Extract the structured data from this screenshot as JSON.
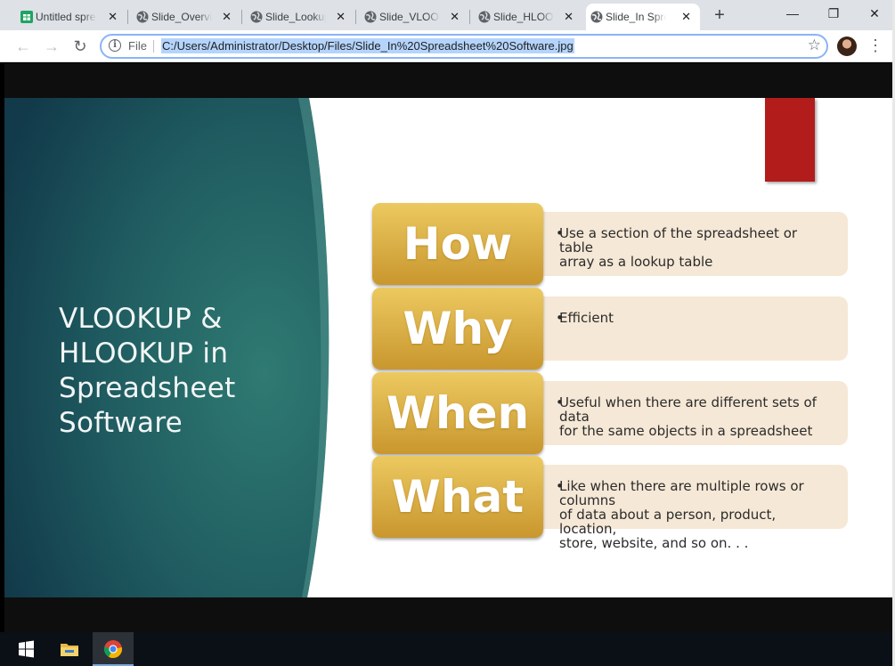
{
  "browser": {
    "tabs": [
      {
        "title": "Untitled spreadsheet",
        "icon": "sheets-icon",
        "active": false
      },
      {
        "title": "Slide_Overview",
        "icon": "globe-icon",
        "active": false
      },
      {
        "title": "Slide_Lookup",
        "icon": "globe-icon",
        "active": false
      },
      {
        "title": "Slide_VLOOKUP",
        "icon": "globe-icon",
        "active": false
      },
      {
        "title": "Slide_HLOOKUP",
        "icon": "globe-icon",
        "active": false
      },
      {
        "title": "Slide_In Spreadsheet",
        "icon": "globe-icon",
        "active": true
      }
    ],
    "scheme_label": "File",
    "url": "C:/Users/Administrator/Desktop/Files/Slide_In%20Spreadsheet%20Software.jpg",
    "accent_color": "#8ab4f8"
  },
  "slide": {
    "title_lines": [
      "VLOOKUP &",
      "HLOOKUP in",
      "Spreadsheet",
      "Software"
    ],
    "rows": [
      {
        "word": "How",
        "lines": [
          "Use a section of the spreadsheet or table",
          "array as a lookup table"
        ]
      },
      {
        "word": "Why",
        "lines": [
          "Efficient"
        ]
      },
      {
        "word": "When",
        "lines": [
          "Useful when there are different sets of data",
          "for the same objects in a spreadsheet"
        ]
      },
      {
        "word": "What",
        "lines": [
          "Like when there are multiple rows or columns",
          "of data about a person, product, location,",
          "store, website, and so on. . ."
        ]
      }
    ],
    "colors": {
      "teal": "#1e5a60",
      "gold": "#dcb24a",
      "desc_bg": "#f6e8d6",
      "red": "#b21d1b"
    }
  },
  "taskbar": {
    "items": [
      {
        "name": "windows-start-icon"
      },
      {
        "name": "file-explorer-icon"
      },
      {
        "name": "chrome-icon",
        "active": true
      }
    ]
  }
}
